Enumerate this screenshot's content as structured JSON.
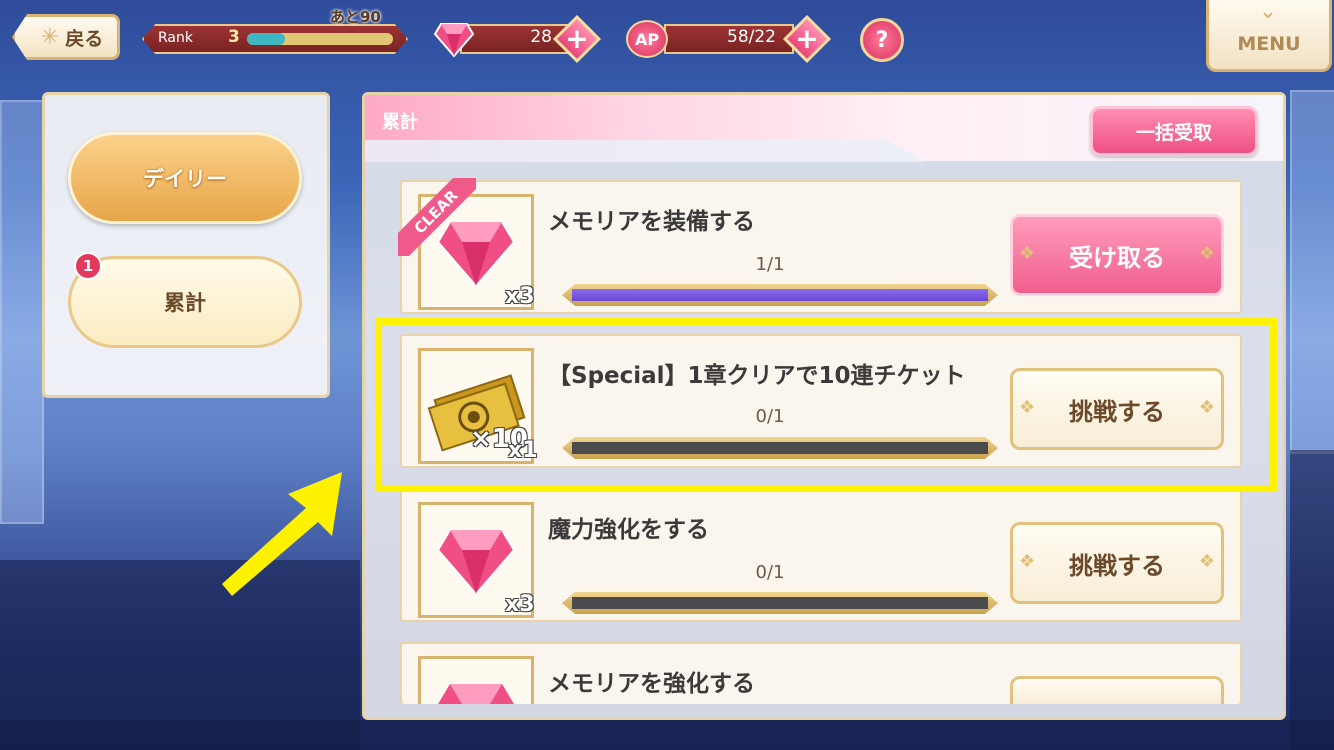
{
  "top_bar": {
    "back_label": "戻る",
    "rank_label": "Rank",
    "rank_value": "3",
    "rank_next": "あと90",
    "rank_progress": 0.26,
    "gems": "28",
    "ap_label": "AP",
    "ap_value": "58/22",
    "help_label": "?",
    "menu_label": "MENU"
  },
  "sidebar": {
    "tabs": [
      {
        "label": "デイリー"
      },
      {
        "label": "累計",
        "badge": "1"
      }
    ]
  },
  "main": {
    "title": "累計",
    "claim_all_label": "一括受取",
    "clear_label": "CLEAR",
    "missions": [
      {
        "title": "メモリアを装備する",
        "progress_text": "1/1",
        "progress": 1.0,
        "reward_qty": "x3",
        "action": "受け取る"
      },
      {
        "title": "【Special】1章クリアで10連チケット",
        "progress_text": "0/1",
        "progress": 0.0,
        "reward_qty": "x1",
        "reward_overlay": "×10",
        "action": "挑戦する"
      },
      {
        "title": "魔力強化をする",
        "progress_text": "0/1",
        "progress": 0.0,
        "reward_qty": "x3",
        "action": "挑戦する"
      },
      {
        "title": "メモリアを強化する"
      }
    ]
  },
  "colors": {
    "accent_pink": "#ef5a8a",
    "gold": "#d8b372",
    "highlight": "#fff200"
  }
}
